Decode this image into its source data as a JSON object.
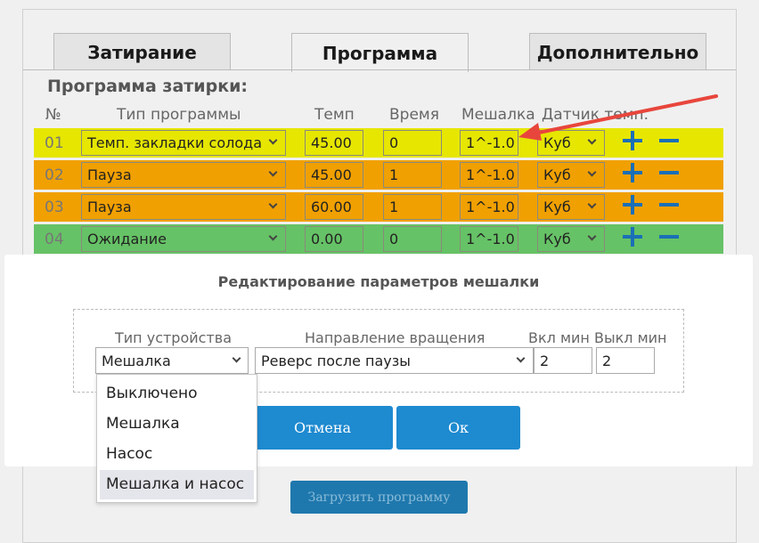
{
  "tabs": [
    {
      "label": "Затирание",
      "active": false
    },
    {
      "label": "Программа",
      "active": true
    },
    {
      "label": "Дополнительно",
      "active": false
    }
  ],
  "program": {
    "title": "Программа затирки:",
    "headers": [
      "№",
      "Тип программы",
      "Темп",
      "Время",
      "Мешалка",
      "Датчик темп."
    ],
    "rows": [
      {
        "num": "01",
        "type": "Темп. закладки солода",
        "temp": "45.00",
        "time": "0",
        "mixer": "1^-1.0",
        "sensor": "Куб",
        "color": "#e6e600"
      },
      {
        "num": "02",
        "type": "Пауза",
        "temp": "45.00",
        "time": "1",
        "mixer": "1^-1.0",
        "sensor": "Куб",
        "color": "#f0a000"
      },
      {
        "num": "03",
        "type": "Пауза",
        "temp": "60.00",
        "time": "1",
        "mixer": "1^-1.0",
        "sensor": "Куб",
        "color": "#f0a000"
      },
      {
        "num": "04",
        "type": "Ожидание",
        "temp": "0.00",
        "time": "0",
        "mixer": "1^-1.0",
        "sensor": "Куб",
        "color": "#66c266"
      }
    ]
  },
  "modal": {
    "title": "Редактирование параметров мешалки",
    "device_type_label": "Тип устройства",
    "device_type_value": "Мешалка",
    "direction_label": "Направление вращения",
    "direction_value": "Реверс после паузы",
    "on_label": "Вкл мин",
    "on_value": "2",
    "off_label": "Выкл мин",
    "off_value": "2",
    "cancel_label": "Отмена",
    "ok_label": "Ок"
  },
  "device_dropdown": {
    "options": [
      "Выключено",
      "Мешалка",
      "Насос",
      "Мешалка и насос"
    ],
    "highlighted": "Мешалка и насос"
  },
  "footer": {
    "load_label": "Загрузить программу"
  },
  "colors": {
    "accent": "#1e8ad0",
    "row_yellow": "#e6e600",
    "row_orange": "#f0a000",
    "row_green": "#66c266",
    "annotation_arrow": "#e8463c"
  },
  "icons": [
    "plus-icon",
    "minus-icon",
    "chevron-down-icon",
    "red-arrow-annotation"
  ]
}
